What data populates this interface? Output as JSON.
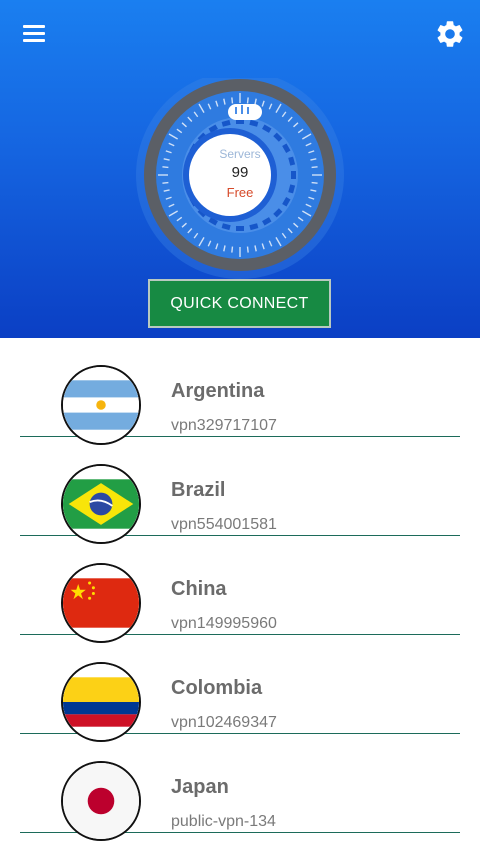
{
  "header": {
    "menu_icon": "hamburger-menu-icon",
    "settings_icon": "gear-icon",
    "colors": {
      "top": "#1a7ff0",
      "bottom": "#0b3fc4"
    }
  },
  "status": {
    "servers_label": "Servers",
    "servers_count": "99",
    "plan_label": "Free"
  },
  "quick_connect": {
    "label": "QUICK CONNECT",
    "color": "#178a43"
  },
  "servers": [
    {
      "country": "Argentina",
      "server": "vpn329717107",
      "flag_icon": "argentina-flag-icon"
    },
    {
      "country": "Brazil",
      "server": "vpn554001581",
      "flag_icon": "brazil-flag-icon"
    },
    {
      "country": "China",
      "server": "vpn149995960",
      "flag_icon": "china-flag-icon"
    },
    {
      "country": "Colombia",
      "server": "vpn102469347",
      "flag_icon": "colombia-flag-icon"
    },
    {
      "country": "Japan",
      "server": "public-vpn-134",
      "flag_icon": "japan-flag-icon"
    }
  ]
}
